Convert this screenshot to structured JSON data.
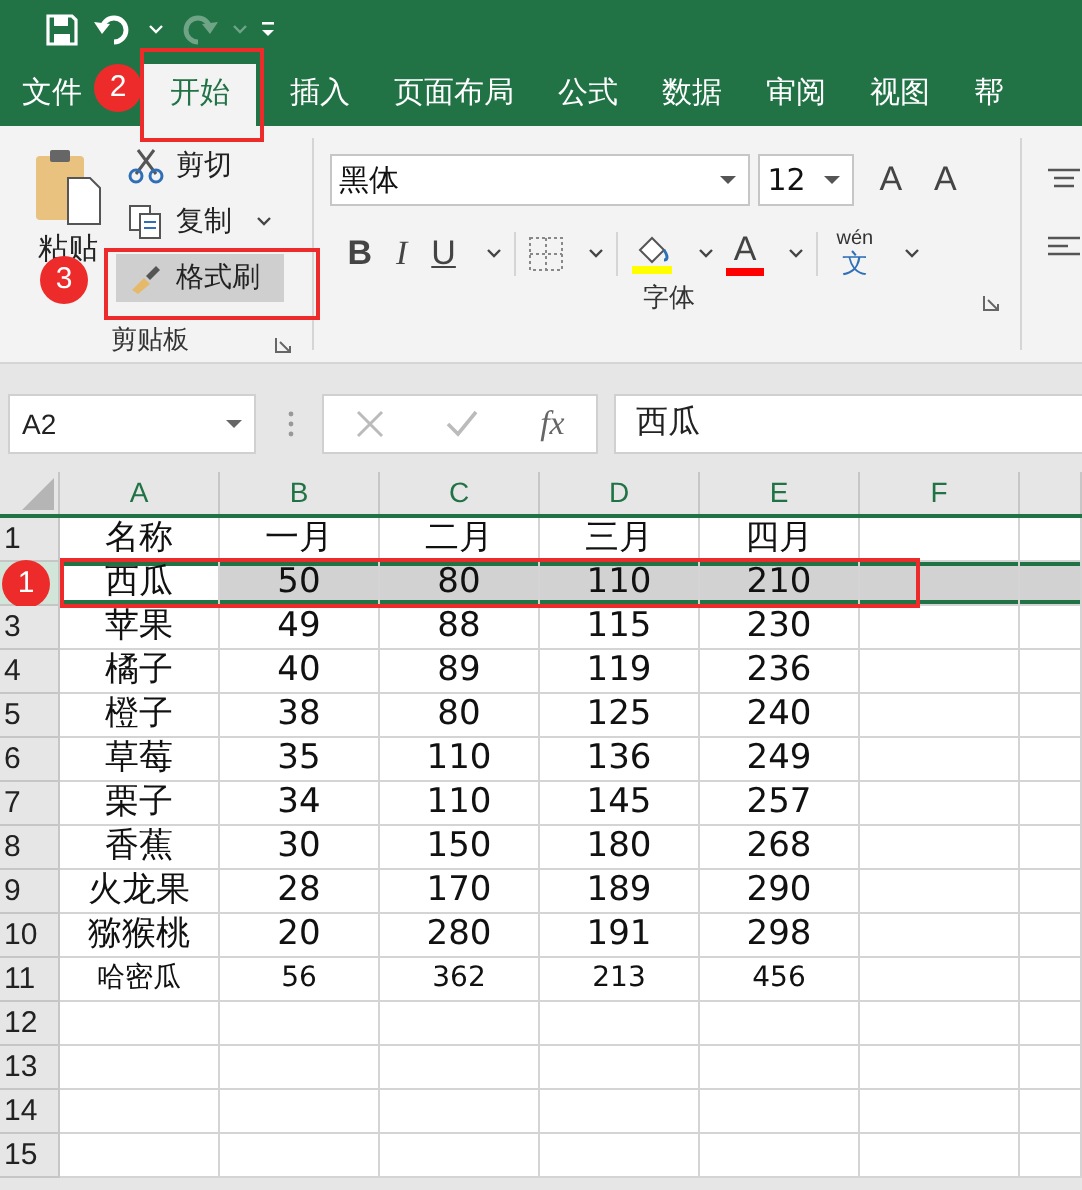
{
  "quick_access": {
    "redo": {
      "disabled": true
    }
  },
  "tabs": [
    {
      "label": "文件",
      "selected": false
    },
    {
      "label": "开始",
      "selected": true
    },
    {
      "label": "插入",
      "selected": false
    },
    {
      "label": "页面布局",
      "selected": false
    },
    {
      "label": "公式",
      "selected": false
    },
    {
      "label": "数据",
      "selected": false
    },
    {
      "label": "审阅",
      "selected": false
    },
    {
      "label": "视图",
      "selected": false
    },
    {
      "label": "帮",
      "selected": false
    }
  ],
  "clipboard": {
    "label": "剪贴板",
    "paste": "粘贴",
    "items": [
      {
        "kind": "cut",
        "label": "剪切",
        "on": false
      },
      {
        "kind": "copy",
        "label": "复制",
        "on": false
      },
      {
        "kind": "painter",
        "label": "格式刷",
        "on": true
      }
    ]
  },
  "font": {
    "label": "字体",
    "name": "黑体",
    "size": "12",
    "grow": "A",
    "shrink": "A",
    "buttons": [
      {
        "kind": "bold",
        "label": "B"
      },
      {
        "kind": "italic",
        "label": "I"
      },
      {
        "kind": "underline",
        "label": "U"
      },
      {
        "kind": "border"
      },
      {
        "kind": "fill",
        "color": "#ffff00"
      },
      {
        "kind": "font_color",
        "label": "A",
        "color": "#ff0000"
      },
      {
        "kind": "phonetic",
        "label": "wén",
        "sub": "文"
      }
    ]
  },
  "formula_bar": {
    "cell": "A2",
    "fx": "fx",
    "value": "西瓜"
  },
  "grid": {
    "columns": [
      "A",
      "B",
      "C",
      "D",
      "E",
      "F"
    ],
    "rows": [
      {
        "number": "1",
        "kind": "large",
        "selected": false,
        "cells": [
          "名称",
          "一月",
          "二月",
          "三月",
          "四月"
        ]
      },
      {
        "kind": "large",
        "selected": true,
        "cells": [
          "西瓜",
          "50",
          "80",
          "110",
          "210"
        ]
      },
      {
        "number": "3",
        "kind": "large",
        "selected": false,
        "cells": [
          "苹果",
          "49",
          "88",
          "115",
          "230"
        ]
      },
      {
        "number": "4",
        "kind": "large",
        "selected": false,
        "cells": [
          "橘子",
          "40",
          "89",
          "119",
          "236"
        ]
      },
      {
        "number": "5",
        "kind": "large",
        "selected": false,
        "cells": [
          "橙子",
          "38",
          "80",
          "125",
          "240"
        ]
      },
      {
        "number": "6",
        "kind": "large",
        "selected": false,
        "cells": [
          "草莓",
          "35",
          "110",
          "136",
          "249"
        ]
      },
      {
        "number": "7",
        "kind": "large",
        "selected": false,
        "cells": [
          "栗子",
          "34",
          "110",
          "145",
          "257"
        ]
      },
      {
        "number": "8",
        "kind": "large",
        "selected": false,
        "cells": [
          "香蕉",
          "30",
          "150",
          "180",
          "268"
        ]
      },
      {
        "number": "9",
        "kind": "large",
        "selected": false,
        "cells": [
          "火龙果",
          "28",
          "170",
          "189",
          "290"
        ]
      },
      {
        "number": "10",
        "kind": "large",
        "selected": false,
        "cells": [
          "猕猴桃",
          "20",
          "280",
          "191",
          "298"
        ]
      },
      {
        "number": "11",
        "kind": "small",
        "selected": false,
        "cells": [
          "哈密瓜",
          "56",
          "362",
          "213",
          "456"
        ]
      },
      {
        "number": "12",
        "kind": "large",
        "selected": false
      },
      {
        "number": "13",
        "kind": "large",
        "selected": false
      },
      {
        "number": "14",
        "kind": "large",
        "selected": false
      },
      {
        "number": "15",
        "kind": "large",
        "selected": false
      }
    ]
  },
  "annotations": [
    {
      "label": "1"
    },
    {
      "label": "2"
    },
    {
      "label": "3"
    }
  ]
}
